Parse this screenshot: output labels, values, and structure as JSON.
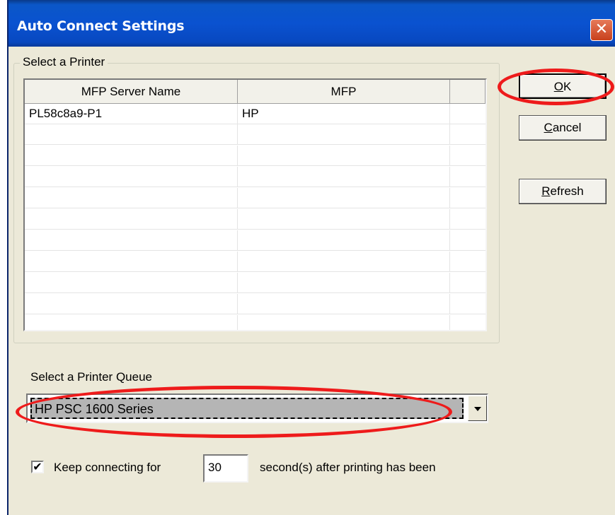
{
  "window": {
    "title": "Auto Connect Settings",
    "close_glyph": "✕"
  },
  "printer_group": {
    "label": "Select a Printer",
    "columns": [
      "MFP Server Name",
      "MFP"
    ],
    "rows": [
      {
        "server": "PL58c8a9-P1",
        "mfp": "HP"
      }
    ]
  },
  "buttons": {
    "ok_mnemonic": "O",
    "ok_rest": "K",
    "cancel_mnemonic": "C",
    "cancel_rest": "ancel",
    "refresh_mnemonic": "R",
    "refresh_rest": "efresh"
  },
  "queue": {
    "label": "Select a Printer Queue",
    "selected": "HP PSC 1600 Series"
  },
  "keep": {
    "checked": true,
    "check_glyph": "✔",
    "label": "Keep connecting for",
    "seconds": "30",
    "suffix": "second(s) after printing has been"
  },
  "colors": {
    "annotation_red": "#ee1b1b",
    "titlebar_blue": "#0a52d0"
  }
}
